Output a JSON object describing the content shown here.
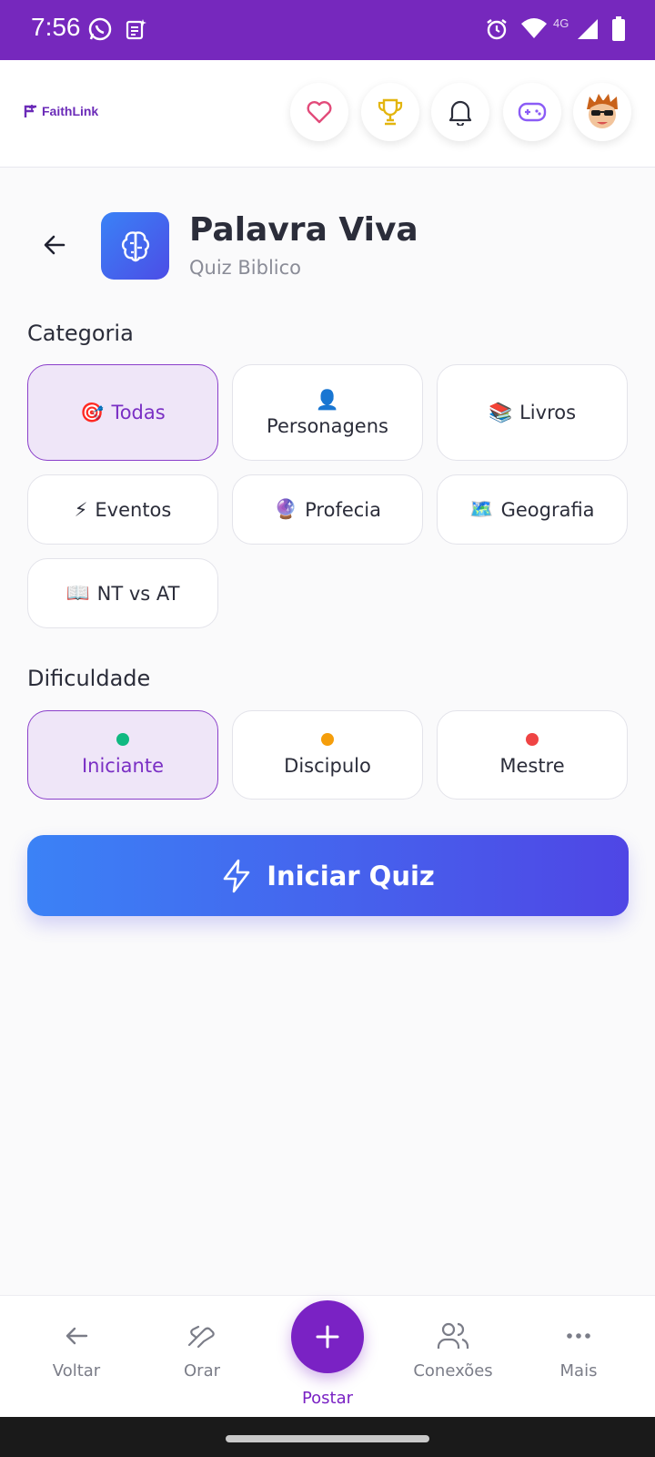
{
  "status_bar": {
    "time": "7:56",
    "network": "4G"
  },
  "header": {
    "logo": "FaithLink",
    "icons": [
      "heart-icon",
      "trophy-icon",
      "bell-icon",
      "gamepad-icon",
      "avatar"
    ]
  },
  "page": {
    "title": "Palavra Viva",
    "subtitle": "Quiz Biblico"
  },
  "category": {
    "label": "Categoria",
    "options": [
      {
        "emoji": "🎯",
        "label": "Todas",
        "selected": true
      },
      {
        "emoji": "👤",
        "label": "Personagens",
        "selected": false
      },
      {
        "emoji": "📚",
        "label": "Livros",
        "selected": false
      },
      {
        "emoji": "⚡",
        "label": "Eventos",
        "selected": false
      },
      {
        "emoji": "🔮",
        "label": "Profecia",
        "selected": false
      },
      {
        "emoji": "🗺️",
        "label": "Geografia",
        "selected": false
      },
      {
        "emoji": "📖",
        "label": "NT vs AT",
        "selected": false
      }
    ]
  },
  "difficulty": {
    "label": "Dificuldade",
    "options": [
      {
        "label": "Iniciante",
        "color": "#10b981",
        "selected": true
      },
      {
        "label": "Discipulo",
        "color": "#f59e0b",
        "selected": false
      },
      {
        "label": "Mestre",
        "color": "#ef4444",
        "selected": false
      }
    ]
  },
  "start_button": {
    "label": "Iniciar Quiz"
  },
  "bottom_nav": {
    "items": [
      {
        "label": "Voltar",
        "icon": "arrow-left-icon"
      },
      {
        "label": "Orar",
        "icon": "praying-hands-icon"
      },
      {
        "label": "Postar",
        "icon": "plus-icon"
      },
      {
        "label": "Conexões",
        "icon": "users-icon"
      },
      {
        "label": "Mais",
        "icon": "more-icon"
      }
    ]
  },
  "colors": {
    "accent": "#7628bd",
    "button_start": "#3b82f6",
    "button_end": "#4f46e5"
  }
}
